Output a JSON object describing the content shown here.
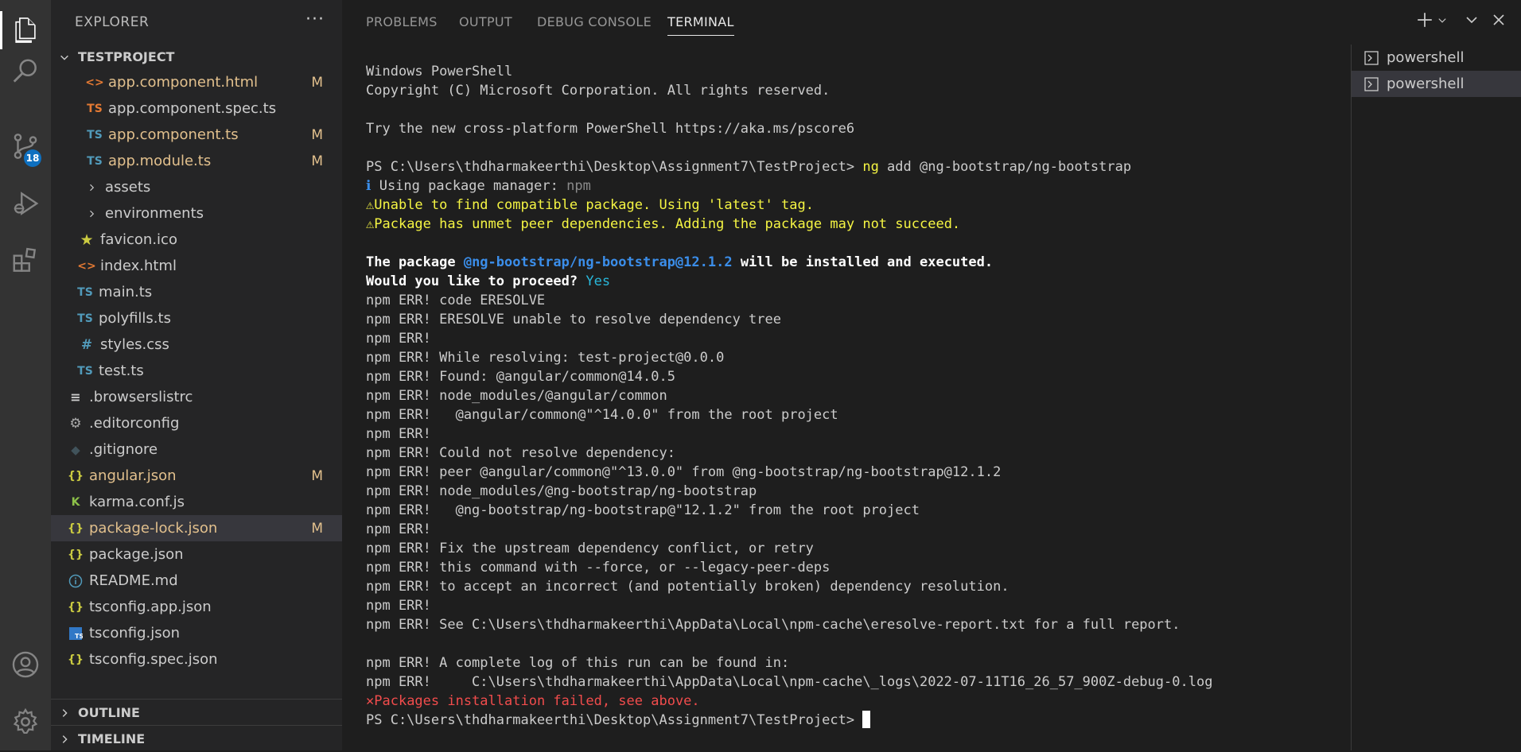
{
  "activity_bar": {
    "items": [
      {
        "icon": "files-icon"
      },
      {
        "icon": "search-icon"
      },
      {
        "icon": "source-control-icon",
        "badge": "18"
      },
      {
        "icon": "run-debug-icon"
      },
      {
        "icon": "extensions-icon"
      },
      {
        "icon": "account-icon"
      },
      {
        "icon": "settings-gear-icon"
      }
    ]
  },
  "explorer": {
    "title": "EXPLORER",
    "more": "···",
    "project_header": "TESTPROJECT",
    "outline_header": "OUTLINE",
    "timeline_header": "TIMELINE",
    "items": [
      {
        "name": "app.component.html",
        "status": "M",
        "icon": "html-icon"
      },
      {
        "name": "app.component.spec.ts",
        "status": "",
        "icon": "ts-icon"
      },
      {
        "name": "app.component.ts",
        "status": "M",
        "icon": "ts-icon"
      },
      {
        "name": "app.module.ts",
        "status": "M",
        "icon": "ts-icon"
      },
      {
        "name": "assets",
        "status": "",
        "icon": "chevron-right-icon"
      },
      {
        "name": "environments",
        "status": "",
        "icon": "chevron-right-icon"
      },
      {
        "name": "favicon.ico",
        "status": "",
        "icon": "star-icon"
      },
      {
        "name": "index.html",
        "status": "",
        "icon": "html-icon"
      },
      {
        "name": "main.ts",
        "status": "",
        "icon": "ts-icon"
      },
      {
        "name": "polyfills.ts",
        "status": "",
        "icon": "ts-icon"
      },
      {
        "name": "styles.css",
        "status": "",
        "icon": "css-icon"
      },
      {
        "name": "test.ts",
        "status": "",
        "icon": "ts-icon"
      },
      {
        "name": ".browserslistrc",
        "status": "",
        "icon": "lines-icon"
      },
      {
        "name": ".editorconfig",
        "status": "",
        "icon": "gear-icon"
      },
      {
        "name": ".gitignore",
        "status": "",
        "icon": "git-icon"
      },
      {
        "name": "angular.json",
        "status": "M",
        "icon": "json-icon"
      },
      {
        "name": "karma.conf.js",
        "status": "",
        "icon": "karma-icon"
      },
      {
        "name": "package-lock.json",
        "status": "M",
        "icon": "json-icon"
      },
      {
        "name": "package.json",
        "status": "",
        "icon": "json-icon"
      },
      {
        "name": "README.md",
        "status": "",
        "icon": "info-icon"
      },
      {
        "name": "tsconfig.app.json",
        "status": "",
        "icon": "json-icon"
      },
      {
        "name": "tsconfig.json",
        "status": "",
        "icon": "tsconfig-icon"
      },
      {
        "name": "tsconfig.spec.json",
        "status": "",
        "icon": "json-icon"
      }
    ]
  },
  "panel": {
    "tabs": [
      "PROBLEMS",
      "OUTPUT",
      "DEBUG CONSOLE",
      "TERMINAL"
    ],
    "active_tab": "TERMINAL",
    "terminals": [
      "powershell",
      "powershell"
    ]
  },
  "terminal": {
    "l1": "Windows PowerShell",
    "l2": "Copyright (C) Microsoft Corporation. All rights reserved.",
    "l3": "Try the new cross-platform PowerShell https://aka.ms/pscore6",
    "prompt": "PS C:\\Users\\thdharmakeerthi\\Desktop\\Assignment7\\TestProject> ",
    "cmd_ng": "ng",
    "cmd_rest": " add @ng-bootstrap/ng-bootstrap",
    "info_icon": "ℹ",
    "info_label": " Using package manager: ",
    "info_value": "npm",
    "warn_icon": "⚠",
    "warn1": "Unable to find compatible package. Using 'latest' tag.",
    "warn2": "Package has unmet peer dependencies. Adding the package may not succeed.",
    "pkg_a": "The package ",
    "pkg_b": "@ng-bootstrap/ng-bootstrap@12.1.2",
    "pkg_c": " will be installed and executed.",
    "proceed": "Would you like to proceed? ",
    "yes": "Yes",
    "errors": [
      "npm ERR! code ERESOLVE",
      "npm ERR! ERESOLVE unable to resolve dependency tree",
      "npm ERR!",
      "npm ERR! While resolving: test-project@0.0.0",
      "npm ERR! Found: @angular/common@14.0.5",
      "npm ERR! node_modules/@angular/common",
      "npm ERR!   @angular/common@\"^14.0.0\" from the root project",
      "npm ERR!",
      "npm ERR! Could not resolve dependency:",
      "npm ERR! peer @angular/common@\"^13.0.0\" from @ng-bootstrap/ng-bootstrap@12.1.2",
      "npm ERR! node_modules/@ng-bootstrap/ng-bootstrap",
      "npm ERR!   @ng-bootstrap/ng-bootstrap@\"12.1.2\" from the root project",
      "npm ERR!",
      "npm ERR! Fix the upstream dependency conflict, or retry",
      "npm ERR! this command with --force, or --legacy-peer-deps",
      "npm ERR! to accept an incorrect (and potentially broken) dependency resolution.",
      "npm ERR!",
      "npm ERR! See C:\\Users\\thdharmakeerthi\\AppData\\Local\\npm-cache\\eresolve-report.txt for a full report."
    ],
    "log1": "npm ERR! A complete log of this run can be found in:",
    "log2": "npm ERR!     C:\\Users\\thdharmakeerthi\\AppData\\Local\\npm-cache\\_logs\\2022-07-11T16_26_57_900Z-debug-0.log",
    "fail_icon": "✕",
    "fail": "Packages installation failed, see above.",
    "final_prompt": "PS C:\\Users\\thdharmakeerthi\\Desktop\\Assignment7\\TestProject> "
  },
  "colors": {
    "modified": "#e2c08d",
    "badge": "#0e70c0",
    "warning": "#f5f543",
    "error": "#f14c4c",
    "link": "#3b8eea"
  }
}
